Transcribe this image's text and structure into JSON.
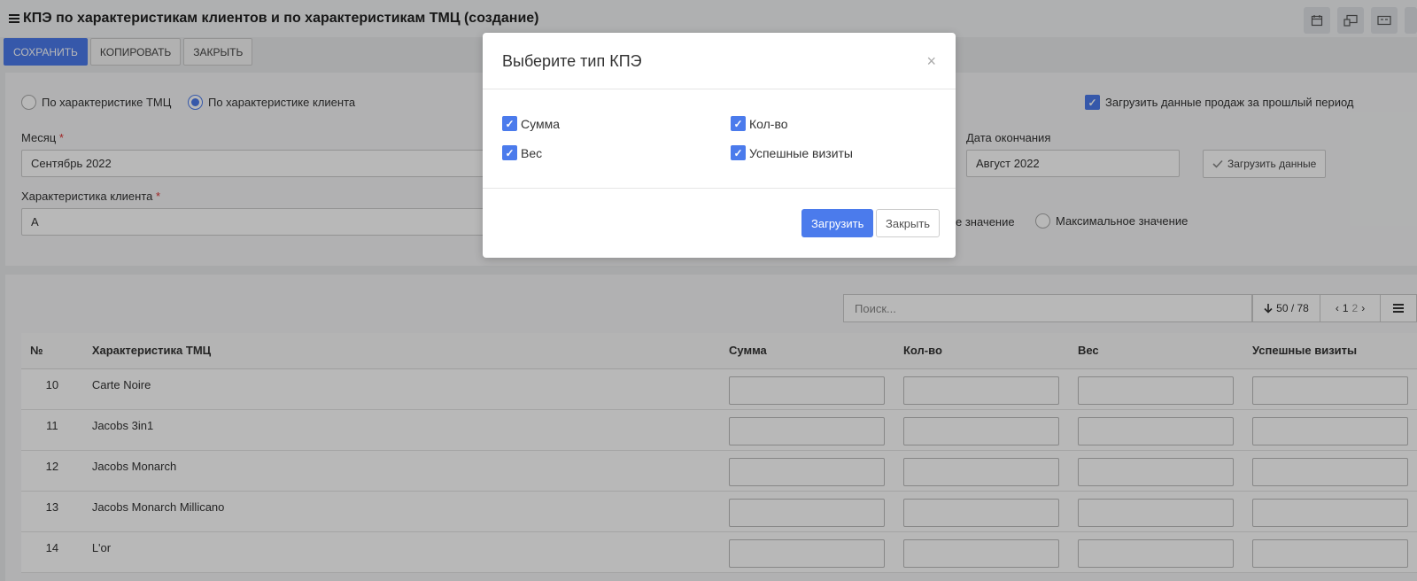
{
  "header": {
    "title": "КПЭ по характеристикам клиентов и по характеристикам ТМЦ (создание)"
  },
  "toolbar": {
    "save_label": "СОХРАНИТЬ",
    "copy_label": "КОПИРОВАТЬ",
    "close_label": "ЗАКРЫТЬ"
  },
  "form": {
    "radio_tmc": "По характеристике ТМЦ",
    "radio_client": "По характеристике клиента",
    "load_prev_sales": "Загрузить данные продаж за прошлый период",
    "month_label": "Месяц",
    "month_value": "Сентябрь 2022",
    "end_date_label": "Дата окончания",
    "end_date_value": "Август 2022",
    "load_data_button": "Загрузить данные",
    "client_char_label": "Характеристика клиента",
    "client_char_value": "А",
    "partial_radio_label": "е значение",
    "max_value_label": "Максимальное значение"
  },
  "table_tools": {
    "search_placeholder": "Поиск...",
    "count": "50 / 78",
    "page_current": "1",
    "page_next": "2"
  },
  "table": {
    "headers": [
      "№",
      "Характеристика ТМЦ",
      "Сумма",
      "Кол-во",
      "Вес",
      "Успешные визиты"
    ],
    "rows": [
      {
        "num": "10",
        "name": "Carte Noire"
      },
      {
        "num": "11",
        "name": "Jacobs 3in1"
      },
      {
        "num": "12",
        "name": "Jacobs Monarch"
      },
      {
        "num": "13",
        "name": "Jacobs Monarch Millicano"
      },
      {
        "num": "14",
        "name": "L'or"
      }
    ]
  },
  "modal": {
    "title": "Выберите тип КПЭ",
    "close_symbol": "×",
    "options": [
      {
        "label": "Сумма",
        "checked": true
      },
      {
        "label": "Кол-во",
        "checked": true
      },
      {
        "label": "Вес",
        "checked": true
      },
      {
        "label": "Успешные визиты",
        "checked": true
      }
    ],
    "load_button": "Загрузить",
    "close_button": "Закрыть"
  },
  "colors": {
    "accent": "#4b7bec",
    "required": "#dd3333"
  },
  "icons": [
    "menu-icon",
    "calendar-icon",
    "monitor-icon",
    "card-icon",
    "checkmark-icon",
    "arrow-down-icon",
    "chevron-left-icon",
    "chevron-right-icon",
    "list-icon",
    "close-icon"
  ]
}
